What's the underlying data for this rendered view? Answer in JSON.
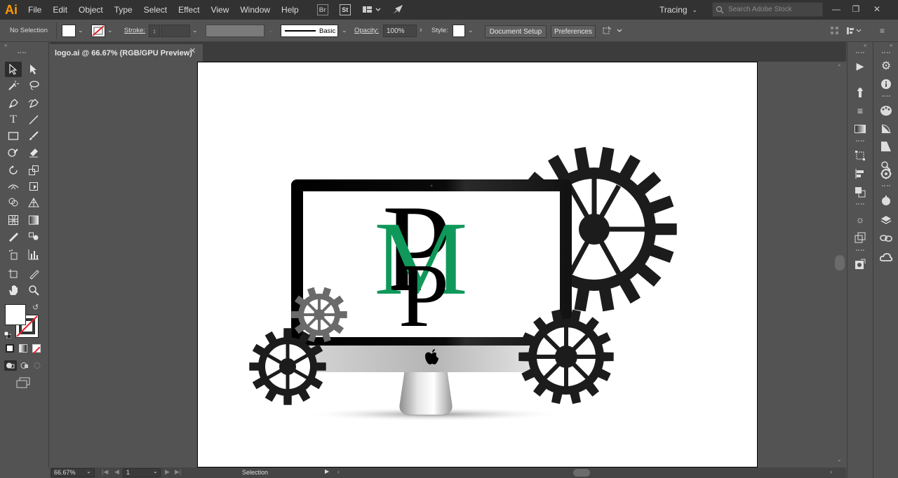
{
  "app": {
    "logo_text": "Ai",
    "brand_color": "#ff9a00"
  },
  "menu": [
    "File",
    "Edit",
    "Object",
    "Type",
    "Select",
    "Effect",
    "View",
    "Window",
    "Help"
  ],
  "menubar_icons": {
    "bridge": "Br",
    "stock": "St",
    "arrange": "arrange-documents-icon",
    "gpu": "gpu-performance-icon"
  },
  "workspace": {
    "label": "Tracing"
  },
  "search": {
    "placeholder": "Search Adobe Stock"
  },
  "control": {
    "selection_label": "No Selection",
    "stroke_label": "Stroke:",
    "brush_label": "Basic",
    "opacity_label": "Opacity:",
    "opacity_value": "100%",
    "style_label": "Style:",
    "document_setup": "Document Setup",
    "preferences": "Preferences"
  },
  "document": {
    "tab_title": "logo.ai @ 66.67% (RGB/GPU Preview)",
    "close_symbol": "✕"
  },
  "status": {
    "zoom": "66.67%",
    "artboard": "1",
    "tool": "Selection"
  },
  "artwork": {
    "monogram_letters": [
      "P",
      "M",
      "P"
    ],
    "monogram_black": "#000000",
    "monogram_green": "#10985a",
    "gear_dark": "#1c1c1c",
    "gear_gray": "#6a6a6a"
  }
}
